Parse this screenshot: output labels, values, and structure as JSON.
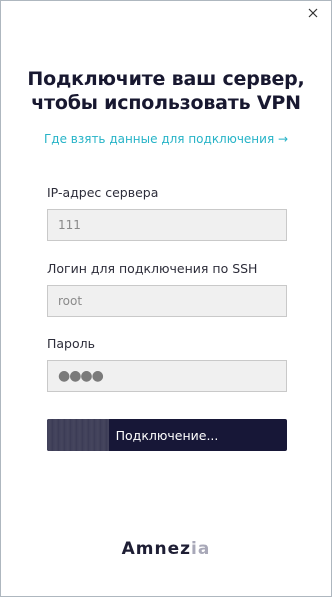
{
  "window": {
    "close_icon": "close-icon"
  },
  "header": {
    "title_line1": "Подключите ваш сервер,",
    "title_line2": "чтобы использовать VPN"
  },
  "help_link": {
    "label": "Где взять данные для подключения →"
  },
  "form": {
    "server": {
      "label": "IP-адрес сервера",
      "value": "111"
    },
    "login": {
      "label": "Логин для подключения по SSH",
      "value": "root"
    },
    "password": {
      "label": "Пароль",
      "masked_value": "●●●●"
    },
    "connect_button": {
      "label": "Подключение...",
      "progress_percent": 26
    }
  },
  "footer": {
    "logo_text": "Amnezia"
  },
  "colors": {
    "accent": "#26b3c7",
    "button_bg": "#171737",
    "title": "#181830"
  }
}
